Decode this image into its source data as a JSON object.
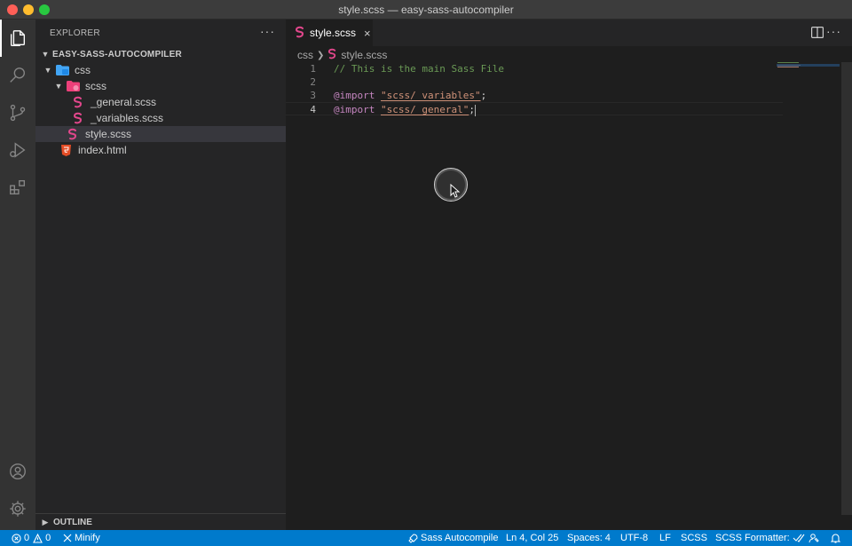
{
  "window": {
    "title": "style.scss — easy-sass-autocompiler"
  },
  "activity_bar": {
    "items": [
      {
        "icon": "files-icon",
        "active": true
      },
      {
        "icon": "search-icon"
      },
      {
        "icon": "source-control-icon"
      },
      {
        "icon": "run-debug-icon"
      },
      {
        "icon": "extensions-icon"
      }
    ],
    "bottom": [
      {
        "icon": "account-icon"
      },
      {
        "icon": "gear-icon"
      }
    ]
  },
  "sidebar": {
    "header": "EXPLORER",
    "more": "···",
    "project": "EASY-SASS-AUTOCOMPILER",
    "tree": [
      {
        "label": "css",
        "type": "folder",
        "level": 1,
        "icon": "css-folder-icon"
      },
      {
        "label": "scss",
        "type": "folder",
        "level": 2,
        "icon": "sass-folder-icon"
      },
      {
        "label": "_general.scss",
        "type": "file",
        "level": 3,
        "icon": "sass-file-icon"
      },
      {
        "label": "_variables.scss",
        "type": "file",
        "level": 3,
        "icon": "sass-file-icon"
      },
      {
        "label": "style.scss",
        "type": "file",
        "level": 2,
        "icon": "sass-file-icon",
        "selected": true
      },
      {
        "label": "index.html",
        "type": "file",
        "level": 1,
        "icon": "html-file-icon"
      }
    ],
    "outline_label": "OUTLINE"
  },
  "editor": {
    "tab": {
      "label": "style.scss",
      "close": "×"
    },
    "more": "···",
    "breadcrumb": [
      "css",
      "style.scss"
    ],
    "lines": [
      {
        "num": "1",
        "comment": "// This is the main Sass File"
      },
      {
        "num": "2"
      },
      {
        "num": "3",
        "keyword": "@import",
        "string": "\"scss/_variables\"",
        "punct": ";"
      },
      {
        "num": "4",
        "keyword": "@import",
        "string": "\"scss/_general\"",
        "punct": ";",
        "current": true
      }
    ]
  },
  "statusbar": {
    "errors": "0",
    "warnings": "0",
    "minify": "Minify",
    "sass": "Sass Autocompile",
    "position": "Ln 4, Col 25",
    "spaces": "Spaces: 4",
    "encoding": "UTF-8",
    "eol": "LF",
    "language": "SCSS",
    "formatter": "SCSS Formatter:"
  },
  "colors": {
    "accent": "#007acc",
    "sass": "#e2478c",
    "html": "#e44d26",
    "css_folder": "#42a5f5"
  }
}
